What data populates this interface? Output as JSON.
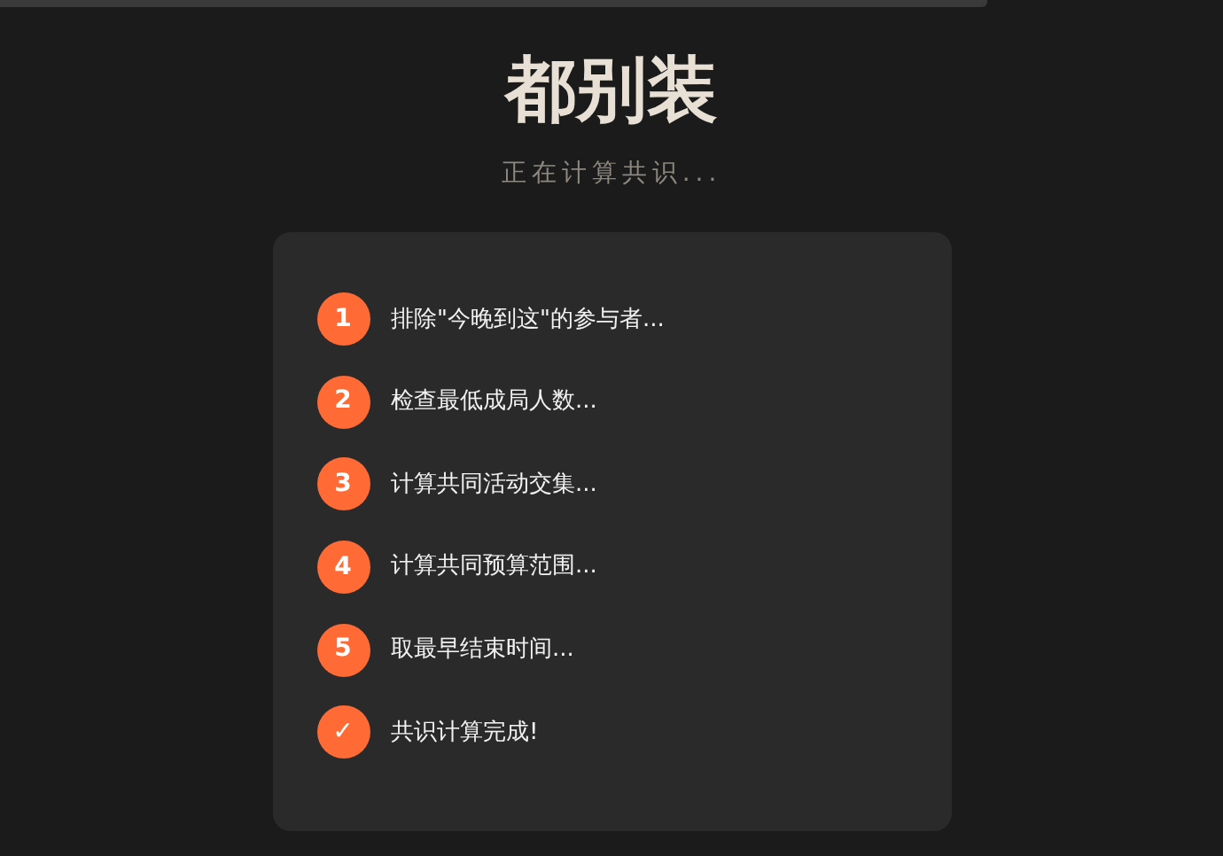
{
  "header": {
    "title": "都别装",
    "subtitle": "正在计算共识..."
  },
  "steps": [
    {
      "marker": "1",
      "label": "排除\"今晚到这\"的参与者..."
    },
    {
      "marker": "2",
      "label": "检查最低成局人数..."
    },
    {
      "marker": "3",
      "label": "计算共同活动交集..."
    },
    {
      "marker": "4",
      "label": "计算共同预算范围..."
    },
    {
      "marker": "5",
      "label": "取最早结束时间..."
    },
    {
      "marker": "✓",
      "label": "共识计算完成!"
    }
  ]
}
